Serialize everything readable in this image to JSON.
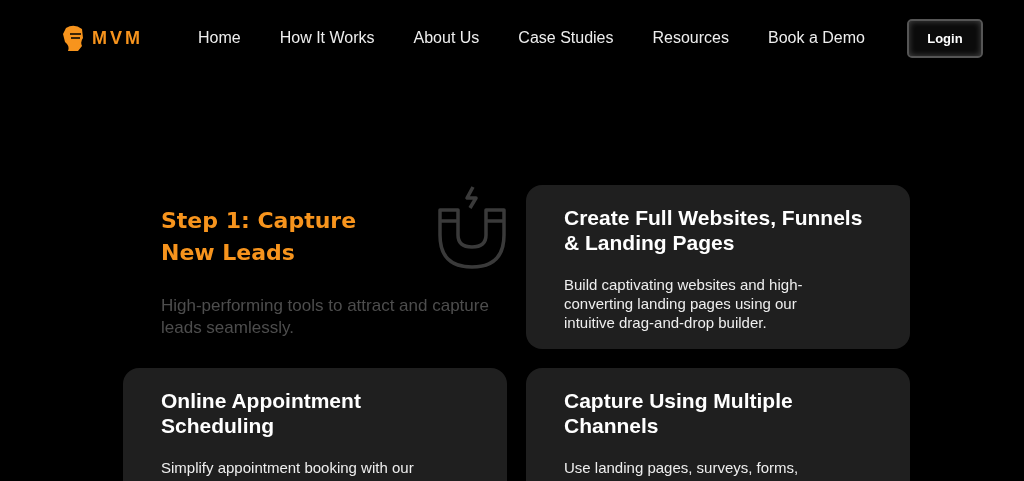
{
  "header": {
    "logo": "MVM",
    "nav": [
      {
        "label": "Home"
      },
      {
        "label": "How It Works"
      },
      {
        "label": "About Us"
      },
      {
        "label": "Case Studies"
      },
      {
        "label": "Resources"
      },
      {
        "label": "Book a Demo"
      }
    ],
    "login": "Login"
  },
  "step": {
    "title": "Step 1: Capture New Leads",
    "subtitle": "High-performing tools to attract and capture leads seamlessly."
  },
  "cards": [
    {
      "title": "Create Full Websites, Funnels & Landing Pages",
      "text": "Build captivating websites and high-converting landing pages using our intuitive drag-and-drop builder."
    },
    {
      "title": "Online Appointment Scheduling",
      "text": "Simplify appointment booking with our"
    },
    {
      "title": "Capture Using Multiple Channels",
      "text": "Use landing pages, surveys, forms,"
    }
  ]
}
